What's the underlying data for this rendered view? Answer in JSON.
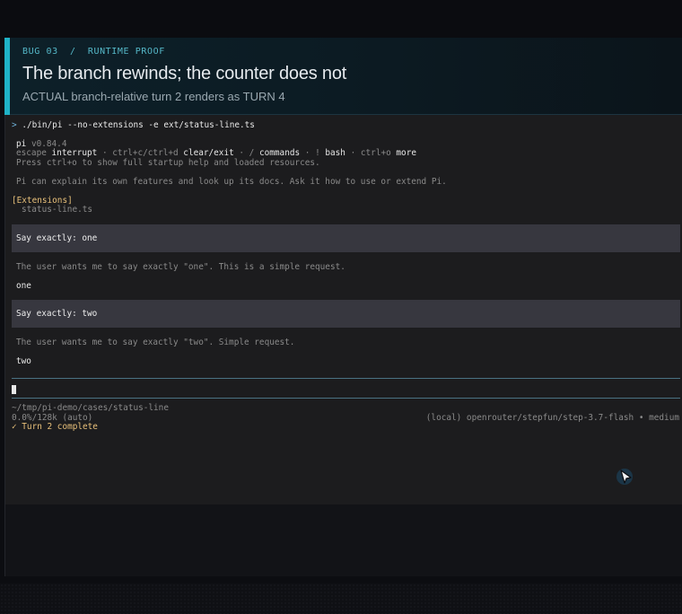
{
  "header": {
    "kicker": "BUG 03  /  RUNTIME PROOF",
    "title": "The branch rewinds; the counter does not",
    "subtitle": "ACTUAL branch-relative turn 2 renders as TURN 4",
    "accent_color": "#1fb2c6"
  },
  "terminal": {
    "command_caret": ">",
    "command": "./bin/pi --no-extensions -e ext/status-line.ts",
    "app_name": "pi",
    "version": "v0.84.4",
    "help_line": {
      "k1": "escape",
      "v1": "interrupt",
      "sep1": " · ctrl+c/ctrl+d ",
      "k2": "clear/exit",
      "sep2": " · / ",
      "k3": "commands",
      "sep3": " · ! ",
      "k4": "bash",
      "sep4": " · ctrl+o ",
      "k5": "more"
    },
    "startup_hint": "Press ctrl+o to show full startup help and loaded resources.",
    "intro": "Pi can explain its own features and look up its docs. Ask it how to use or extend Pi.",
    "extensions_header": "[Extensions]",
    "extension_item": "status-line.ts",
    "messages": [
      {
        "user": "Say exactly: one",
        "thinking": "The user wants me to say exactly \"one\". This is a simple request.",
        "reply": "one"
      },
      {
        "user": "Say exactly: two",
        "thinking": "The user wants me to say exactly \"two\". Simple request.",
        "reply": "two"
      }
    ],
    "footer": {
      "cwd": "~/tmp/pi-demo/cases/status-line",
      "context_usage": "0.0%/128k (auto)",
      "model": "(local) openrouter/stepfun/step-3.7-flash • medium",
      "status": "✓ Turn 2 complete"
    }
  },
  "icons": {
    "pointer": "mouse-pointer-icon"
  }
}
